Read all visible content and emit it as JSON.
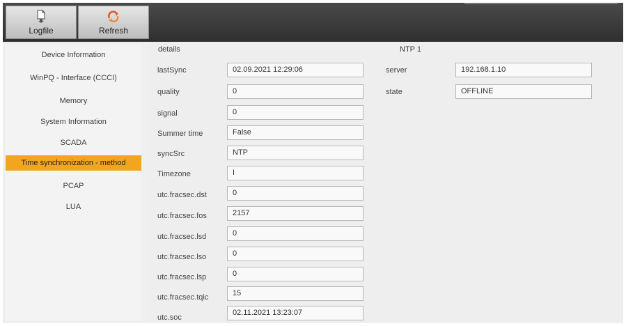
{
  "toolbar": {
    "logfile_label": "Logfile",
    "refresh_label": "Refresh",
    "logfile_icon": "document-download-icon",
    "refresh_icon": "refresh-icon"
  },
  "sidebar": {
    "items": [
      {
        "label": "Device Information"
      },
      {
        "label": "WinPQ - Interface (CCCI)"
      },
      {
        "label": "Memory"
      },
      {
        "label": "System Information"
      },
      {
        "label": "SCADA"
      },
      {
        "label": "Time synchronization - method"
      },
      {
        "label": "PCAP"
      },
      {
        "label": "LUA"
      }
    ],
    "active_index": 5
  },
  "details": {
    "title": "details",
    "rows": [
      {
        "label": "lastSync",
        "value": "02.09.2021 12:29:06"
      },
      {
        "label": "quality",
        "value": "0"
      },
      {
        "label": "signal",
        "value": "0"
      },
      {
        "label": "Summer time",
        "value": "False"
      },
      {
        "label": "syncSrc",
        "value": "NTP"
      },
      {
        "label": "Timezone",
        "value": "I"
      },
      {
        "label": "utc.fracsec.dst",
        "value": "0"
      },
      {
        "label": "utc.fracsec.fos",
        "value": "2157"
      },
      {
        "label": "utc.fracsec.lsd",
        "value": "0"
      },
      {
        "label": "utc.fracsec.lso",
        "value": "0"
      },
      {
        "label": "utc.fracsec.lsp",
        "value": "0"
      },
      {
        "label": "utc.fracsec.tqic",
        "value": "15"
      },
      {
        "label": "utc.soc",
        "value": "02.11.2021 13:23:07"
      }
    ]
  },
  "ntp": {
    "title": "NTP 1",
    "rows": [
      {
        "label": "server",
        "value": "192.168.1.10"
      },
      {
        "label": "state",
        "value": "OFFLINE"
      }
    ]
  },
  "colors": {
    "active_item": "#f3a51f",
    "toolbar_bg": "#3a3a3a"
  }
}
